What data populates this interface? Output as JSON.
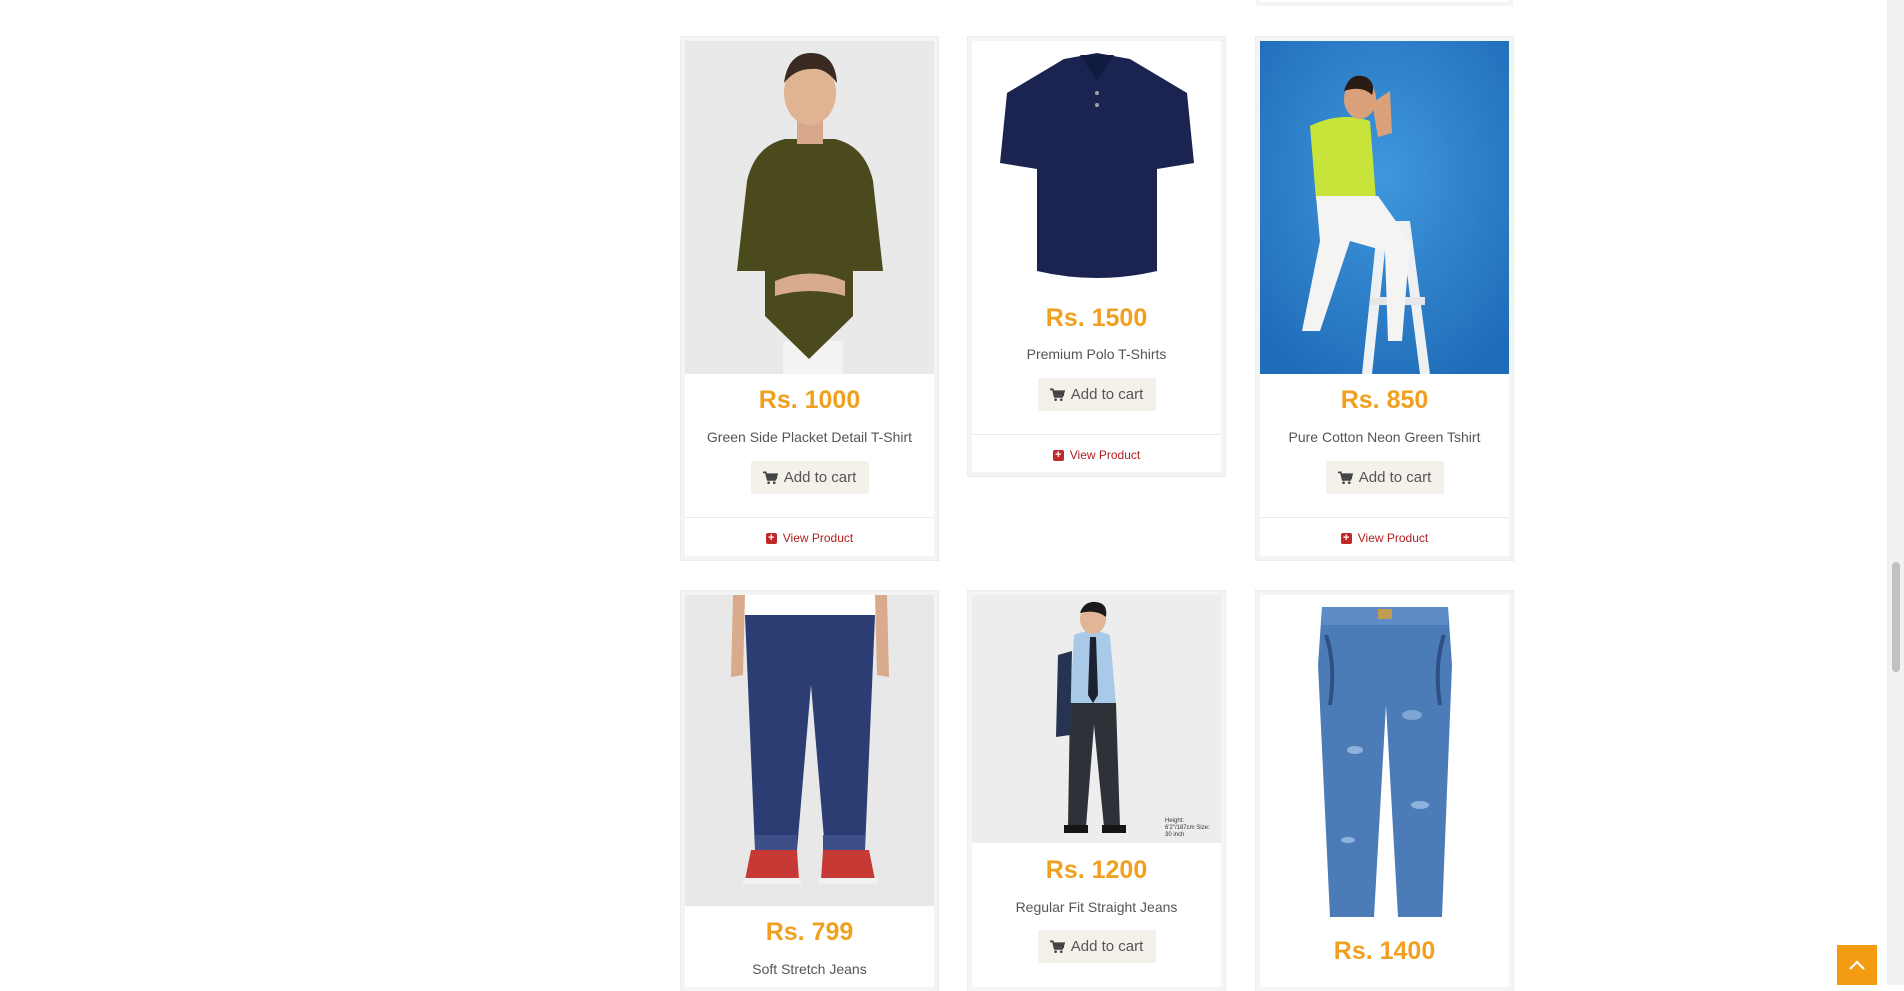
{
  "products": [
    {
      "price": "Rs. 1000",
      "name": "Green Side Placket Detail T-Shirt",
      "cart_label": "Add to cart",
      "view_label": "View Product",
      "image": "olive-tshirt-model"
    },
    {
      "price": "Rs. 1500",
      "name": "Premium Polo T-Shirts",
      "cart_label": "Add to cart",
      "view_label": "View Product",
      "image": "navy-polo-shirt"
    },
    {
      "price": "Rs. 850",
      "name": "Pure Cotton Neon Green Tshirt",
      "cart_label": "Add to cart",
      "view_label": "View Product",
      "image": "neon-tshirt-model-on-stool"
    },
    {
      "price": "Rs. 799",
      "name": "Soft Stretch Jeans",
      "image": "dark-denim-jeans-legs"
    },
    {
      "price": "Rs. 1200",
      "name": "Regular Fit Straight Jeans",
      "cart_label": "Add to cart",
      "image": "model-in-shirt-and-jeans",
      "image_caption": "Height: 6'2\"/187cm Size: 30 inch"
    },
    {
      "price": "Rs. 1400",
      "image": "distressed-blue-jeans"
    }
  ],
  "icons": {
    "cart": "cart-icon",
    "view": "plus-square-icon",
    "back_to_top": "chevron-up-icon"
  },
  "colors": {
    "price": "#f0a020",
    "link": "#b02020",
    "back_to_top": "#f39c12"
  }
}
